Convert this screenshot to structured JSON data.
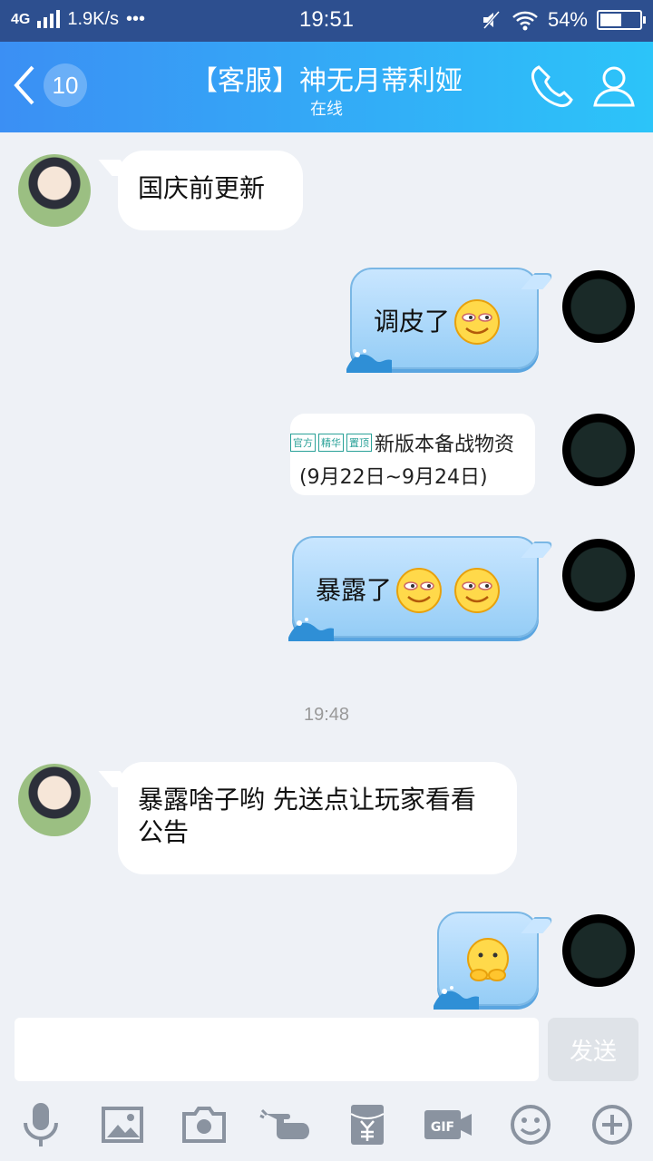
{
  "status_bar": {
    "network": "4G",
    "speed": "1.9K/s",
    "dots": "•••",
    "time": "19:51",
    "battery": "54%",
    "battery_level": 0.54
  },
  "header": {
    "unread_count": "10",
    "title": "【客服】神无月蒂利娅",
    "status": "在线"
  },
  "messages": {
    "m1": "国庆前更新",
    "m2": "调皮了",
    "card_tags": [
      "官方",
      "精华",
      "置顶"
    ],
    "card_title": "新版本备战物资",
    "card_date": "(9月22日~9月24日)",
    "m4": "暴露了",
    "time_separator": "19:48",
    "m5": "暴露啥子哟 先送点让玩家看看公告"
  },
  "input": {
    "value": "",
    "send_label": "发送"
  },
  "colors": {
    "accent": "#3b8ff4",
    "status_bar": "#2d4f8f",
    "background": "#eef1f6"
  },
  "icons": [
    "back-icon",
    "phone-icon",
    "profile-icon",
    "mic-icon",
    "image-icon",
    "camera-icon",
    "poke-icon",
    "red-packet-icon",
    "gif-icon",
    "emoji-icon",
    "plus-icon"
  ]
}
